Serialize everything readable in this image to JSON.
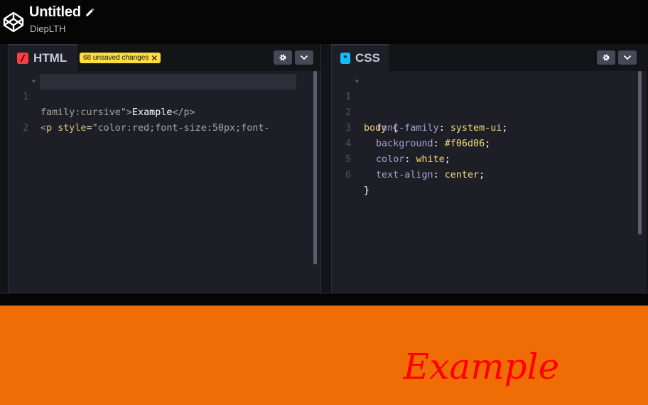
{
  "header": {
    "title": "Untitled",
    "author": "DiepLTH",
    "logo_icon": "codepen-logo-icon",
    "edit_icon": "pencil-icon"
  },
  "html_pane": {
    "tab_label": "HTML",
    "tab_icon": "html-icon",
    "tab_icon_color": "#ff3c41",
    "badge_text": "68 unsaved changes",
    "badge_color": "#ffdd40",
    "line_numbers": [
      "1",
      "2"
    ],
    "code": {
      "open_lt": "<",
      "tag": "p",
      "attr": "style",
      "eq": "=",
      "string_part1": "\"color:red;font-size:50px;font-",
      "string_part2": "family:cursive\"",
      "gt": ">",
      "content": "Example",
      "close_tag": "</p>"
    }
  },
  "css_pane": {
    "tab_label": "CSS",
    "tab_icon": "css-icon",
    "tab_icon_color": "#0ebeff",
    "line_numbers": [
      "1",
      "2",
      "3",
      "4",
      "5",
      "6"
    ],
    "lines": [
      {
        "sel": "body",
        "punc": " {"
      },
      {
        "prop": "font-family",
        "colon": ": ",
        "val": "system-ui",
        "semi": ";"
      },
      {
        "prop": "background",
        "colon": ": ",
        "val": "#f06d06",
        "semi": ";"
      },
      {
        "prop": "color",
        "colon": ": ",
        "val": "white",
        "semi": ";"
      },
      {
        "prop": "text-align",
        "colon": ": ",
        "val": "center",
        "semi": ";"
      },
      {
        "close": "}"
      }
    ]
  },
  "preview": {
    "text": "Example",
    "background": "#f06d06",
    "text_color": "#ff0000"
  }
}
